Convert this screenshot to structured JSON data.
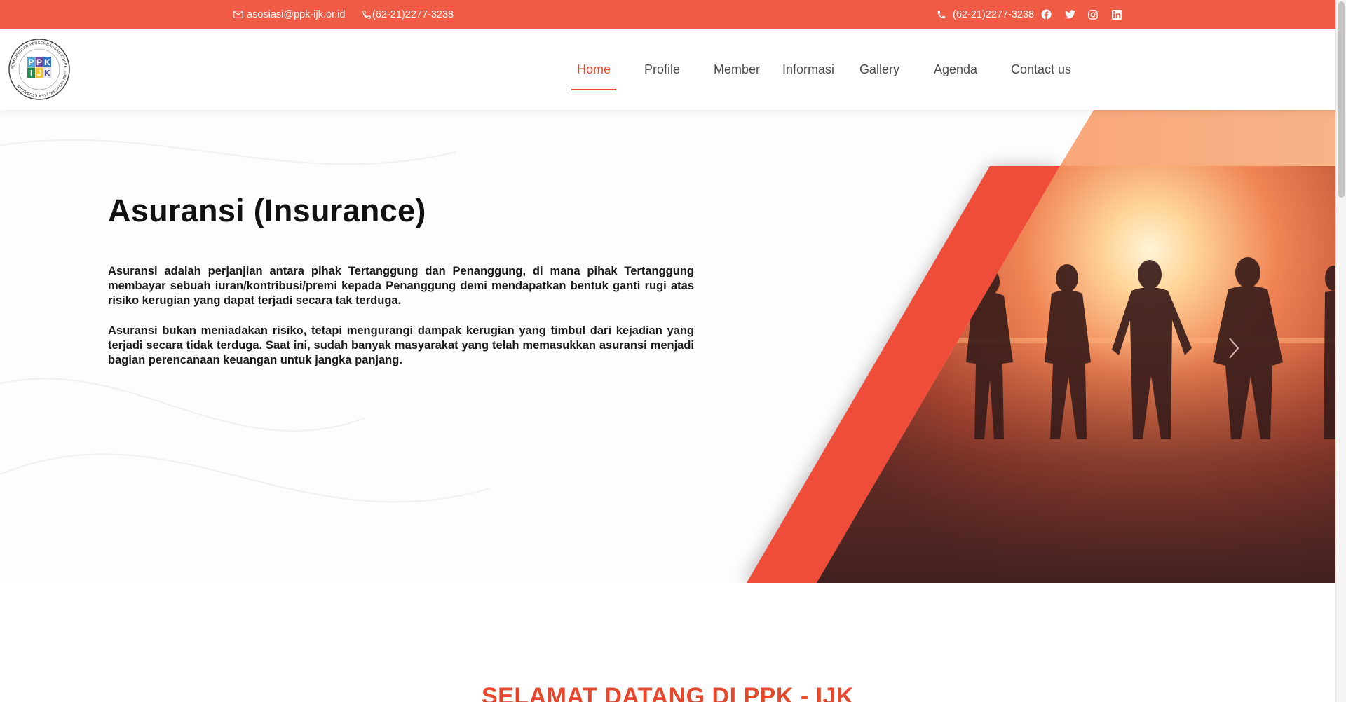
{
  "topbar": {
    "email": "asosiasi@ppk-ijk.or.id",
    "phone_left": "(62-21)2277-3238",
    "phone_right": "(62-21)2277-3238",
    "social": [
      "facebook-icon",
      "twitter-icon",
      "instagram-icon",
      "linkedin-icon"
    ],
    "bg_color": "#ef5b45"
  },
  "logo": {
    "letters": [
      "P",
      "P",
      "K",
      "I",
      "J",
      "K"
    ],
    "ring_text": "PERKUMPULAN PENGEMBANGAN KOMPETENSI INDUSTRI JASA KEUANGAN"
  },
  "nav": {
    "items": [
      "Home",
      "Profile",
      "Member",
      "Informasi",
      "Gallery",
      "Agenda",
      "Contact us"
    ],
    "active": "Home",
    "accent_color": "#e8472b"
  },
  "hero": {
    "title": "Asuransi (Insurance)",
    "paragraph1": "Asuransi adalah perjanjian antara pihak Tertanggung dan Penanggung, di mana pihak Tertanggung membayar sebuah iuran/kontribusi/premi kepada Penanggung demi mendapatkan bentuk ganti rugi atas risiko kerugian yang dapat terjadi secara tak terduga.",
    "paragraph2": "Asuransi bukan meniadakan risiko, tetapi mengurangi dampak kerugian yang timbul dari kejadian yang terjadi secara tidak terduga. Saat ini, sudah banyak masyarakat yang telah memasukkan asuransi menjadi bagian perencanaan keuangan untuk jangka panjang."
  },
  "welcome": {
    "heading": "SELAMAT DATANG DI PPK - IJK"
  }
}
